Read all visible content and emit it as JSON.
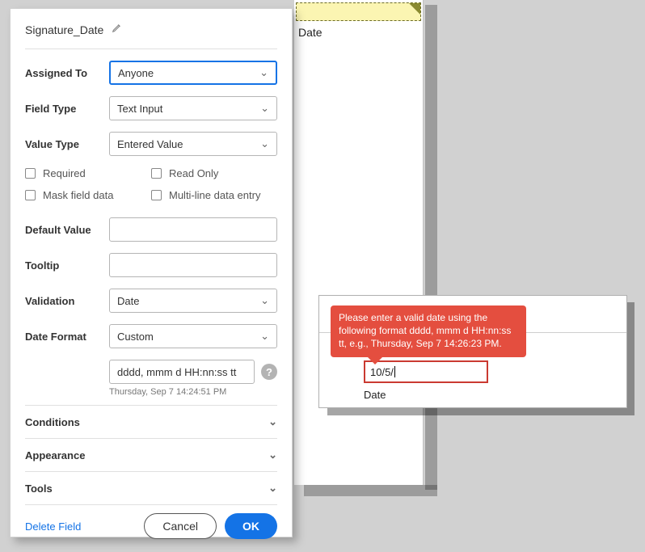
{
  "title": "Signature_Date",
  "fields": {
    "assigned_to": {
      "label": "Assigned To",
      "value": "Anyone"
    },
    "field_type": {
      "label": "Field Type",
      "value": "Text Input"
    },
    "value_type": {
      "label": "Value Type",
      "value": "Entered Value"
    },
    "default_value": {
      "label": "Default Value",
      "value": ""
    },
    "tooltip": {
      "label": "Tooltip",
      "value": ""
    },
    "validation": {
      "label": "Validation",
      "value": "Date"
    },
    "date_format": {
      "label": "Date Format",
      "value": "Custom"
    },
    "format_string": "dddd, mmm d  HH:nn:ss tt",
    "format_preview": "Thursday, Sep 7 14:24:51 PM"
  },
  "checks": {
    "required": "Required",
    "read_only": "Read Only",
    "mask": "Mask field data",
    "multiline": "Multi-line data entry"
  },
  "sections": {
    "conditions": "Conditions",
    "appearance": "Appearance",
    "tools": "Tools"
  },
  "footer": {
    "delete": "Delete Field",
    "cancel": "Cancel",
    "ok": "OK"
  },
  "sticky": {
    "label": "Date"
  },
  "tooltip_text": "Please enter a valid date using the following format dddd, mmm d HH:nn:ss tt, e.g., Thursday, Sep 7 14:26:23 PM.",
  "preview": {
    "input_value": "10/5/",
    "label": "Date"
  }
}
